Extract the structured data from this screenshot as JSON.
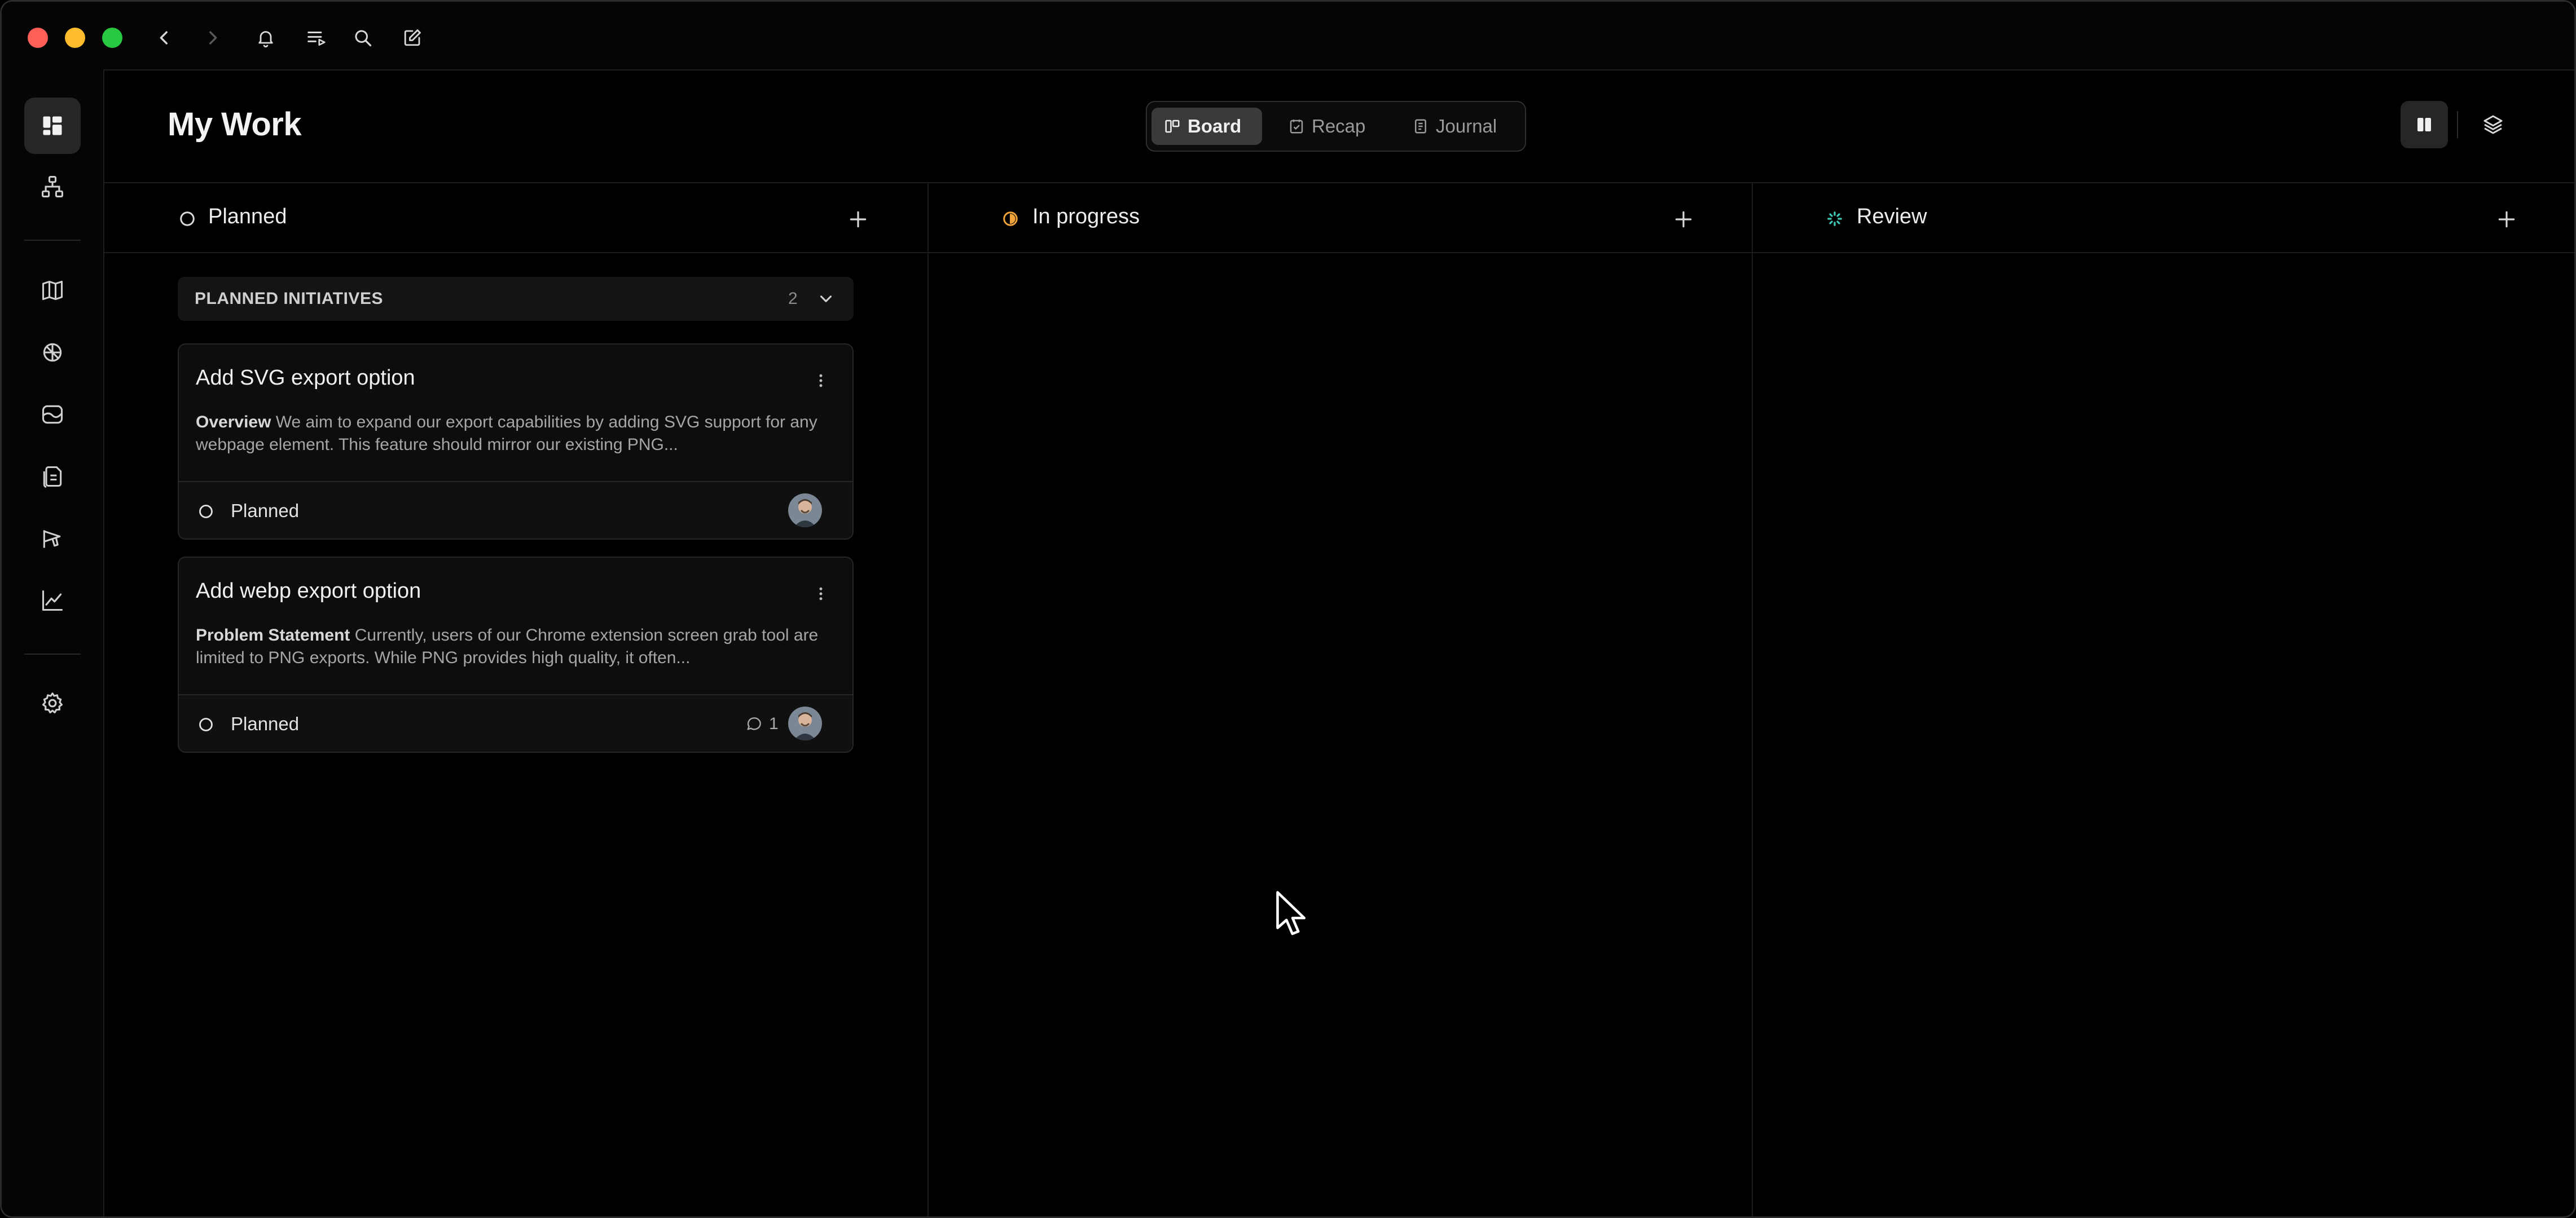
{
  "header": {
    "title": "My Work",
    "views": [
      {
        "label": "Board",
        "active": true
      },
      {
        "label": "Recap",
        "active": false
      },
      {
        "label": "Journal",
        "active": false
      }
    ]
  },
  "columns": [
    {
      "title": "Planned",
      "status_color": "#d9d9d9"
    },
    {
      "title": "In progress",
      "status_color": "#f2a33a"
    },
    {
      "title": "Review",
      "status_color": "#3fc9b8"
    }
  ],
  "group": {
    "label": "PLANNED INITIATIVES",
    "count": "2"
  },
  "cards": [
    {
      "title": "Add SVG export option",
      "desc_lead": "Overview",
      "desc_text": " We aim to expand our export capabilities by adding SVG support for any webpage element. This feature should mirror our existing PNG...",
      "status": "Planned",
      "comments": ""
    },
    {
      "title": "Add webp export option",
      "desc_lead": "Problem Statement",
      "desc_text": " Currently, users of our Chrome extension screen grab tool are limited to PNG exports. While PNG provides high quality, it often...",
      "status": "Planned",
      "comments": "1"
    }
  ],
  "icons": {
    "titlebar": [
      "back-icon",
      "forward-icon",
      "bell-icon",
      "list-icon",
      "search-icon",
      "compose-icon"
    ],
    "sidebar": [
      "board-icon",
      "hierarchy-icon",
      "map-icon",
      "bug-icon",
      "feedback-icon",
      "docs-icon",
      "announcement-icon",
      "analytics-icon",
      "settings-icon"
    ]
  },
  "colors": {
    "traffic_close": "#ff5f57",
    "traffic_minimize": "#febc2e",
    "traffic_zoom": "#28c840"
  }
}
